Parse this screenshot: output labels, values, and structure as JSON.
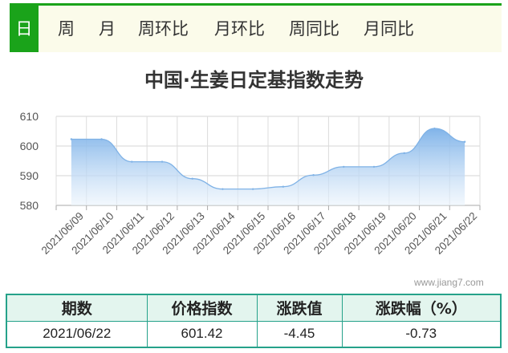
{
  "tabs": [
    {
      "label": "日",
      "active": true
    },
    {
      "label": "周",
      "active": false
    },
    {
      "label": "月",
      "active": false
    },
    {
      "label": "周环比",
      "active": false
    },
    {
      "label": "月环比",
      "active": false
    },
    {
      "label": "周同比",
      "active": false
    },
    {
      "label": "月同比",
      "active": false
    }
  ],
  "watermark": "www.jiang7.com",
  "colors": {
    "accent": "#1aa31a",
    "table_border": "#25a28a",
    "table_header_bg": "#e3f5ee",
    "line": "#7fb2e6",
    "fill_top": "#7ab0e8",
    "fill_bottom": "#eaf3fc"
  },
  "chart_data": {
    "type": "area",
    "title": "中国·生姜日定基指数走势",
    "xlabel": "",
    "ylabel": "",
    "ylim": [
      580,
      610
    ],
    "yticks": [
      610,
      600,
      590,
      580
    ],
    "grid": true,
    "legend": "none",
    "categories": [
      "2021/06/09",
      "2021/06/10",
      "2021/06/11",
      "2021/06/12",
      "2021/06/13",
      "2021/06/14",
      "2021/06/15",
      "2021/06/16",
      "2021/06/17",
      "2021/06/18",
      "2021/06/19",
      "2021/06/20",
      "2021/06/21",
      "2021/06/22"
    ],
    "values": [
      602.3,
      602.3,
      594.7,
      594.7,
      589.0,
      585.5,
      585.5,
      586.3,
      590.2,
      593.0,
      593.0,
      597.6,
      605.9,
      601.42
    ]
  },
  "summary": {
    "headers": [
      "期数",
      "价格指数",
      "涨跌值",
      "涨跌幅（%）"
    ],
    "row": [
      "2021/06/22",
      "601.42",
      "-4.45",
      "-0.73"
    ]
  }
}
